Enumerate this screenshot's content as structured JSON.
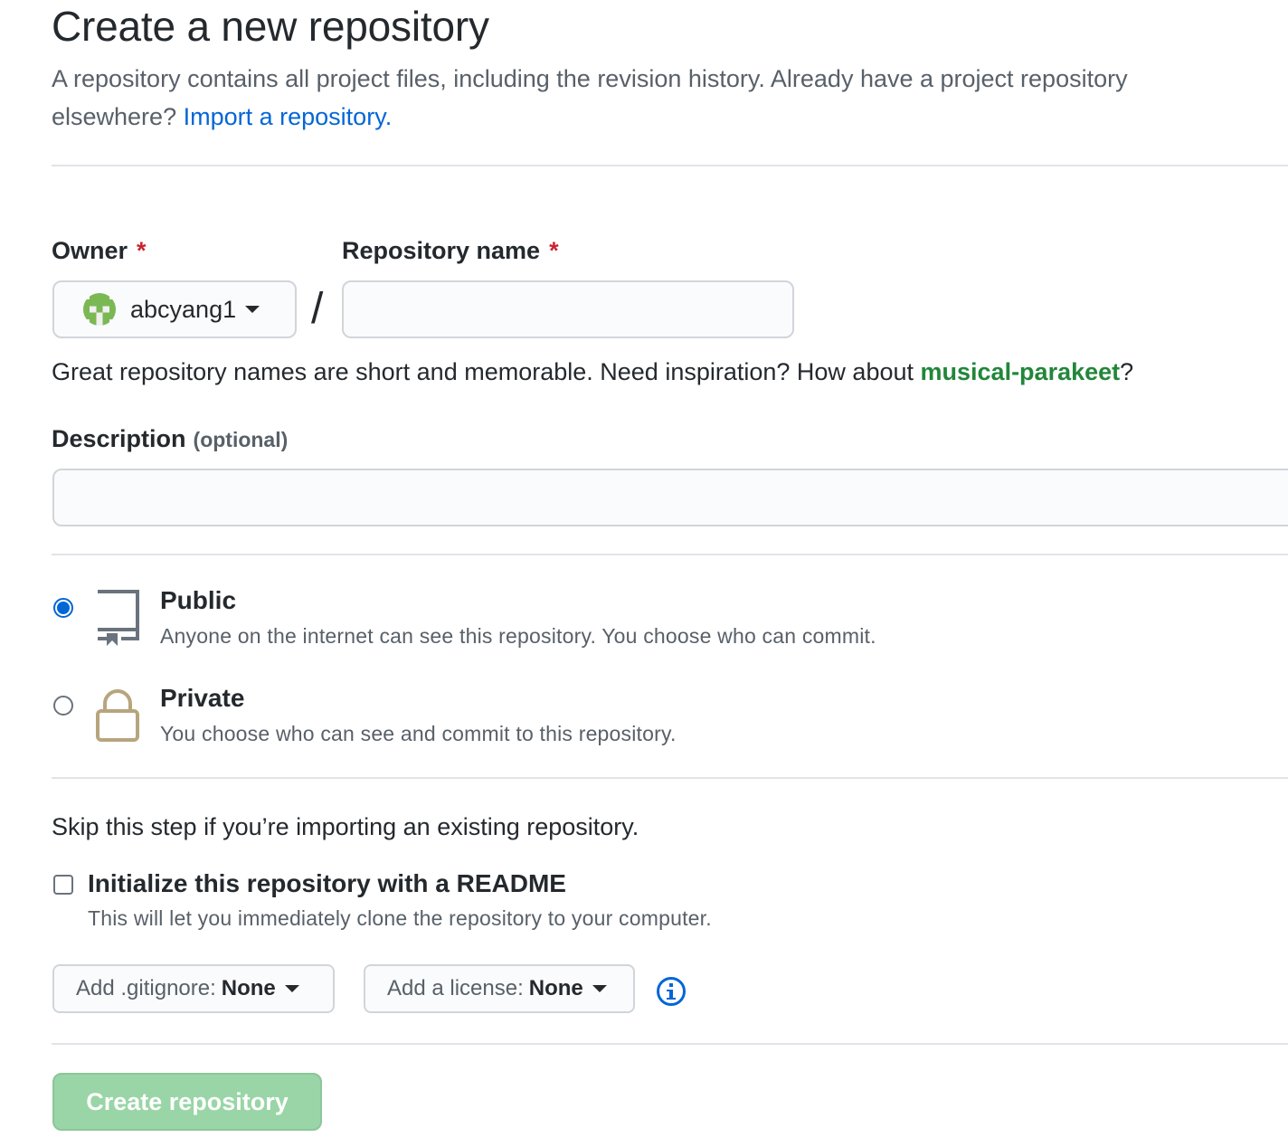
{
  "header": {
    "title": "Create a new repository",
    "intro": "A repository contains all project files, including the revision history. Already have a project repository elsewhere?",
    "import_link": "Import a repository."
  },
  "owner": {
    "label": "Owner",
    "required_mark": "*",
    "value": "abcyang1",
    "icon": "avatar-identicon"
  },
  "repo_name": {
    "label": "Repository name",
    "required_mark": "*",
    "value": "",
    "separator": "/"
  },
  "name_hint": {
    "prefix": "Great repository names are short and memorable. Need inspiration? How about",
    "suggestion": "musical-parakeet",
    "suffix": "?"
  },
  "description": {
    "label": "Description",
    "optional": "(optional)",
    "value": ""
  },
  "visibility": {
    "selected": "public",
    "options": [
      {
        "id": "public",
        "title": "Public",
        "desc": "Anyone on the internet can see this repository. You choose who can commit.",
        "icon": "repo-icon"
      },
      {
        "id": "private",
        "title": "Private",
        "desc": "You choose who can see and commit to this repository.",
        "icon": "lock-icon"
      }
    ]
  },
  "init": {
    "skip_note": "Skip this step if you’re importing an existing repository.",
    "readme_label": "Initialize this repository with a README",
    "readme_desc": "This will let you immediately clone the repository to your computer.",
    "readme_checked": false
  },
  "selects": {
    "gitignore_prefix": "Add .gitignore:",
    "gitignore_value": "None",
    "license_prefix": "Add a license:",
    "license_value": "None",
    "info_icon": "info-icon"
  },
  "submit": {
    "label": "Create repository",
    "disabled": true
  },
  "colors": {
    "link": "#0366d6",
    "suggestion": "#22863a",
    "required": "#cb2431",
    "create_button": "#94d3a2",
    "private_icon": "#b7a57e"
  }
}
